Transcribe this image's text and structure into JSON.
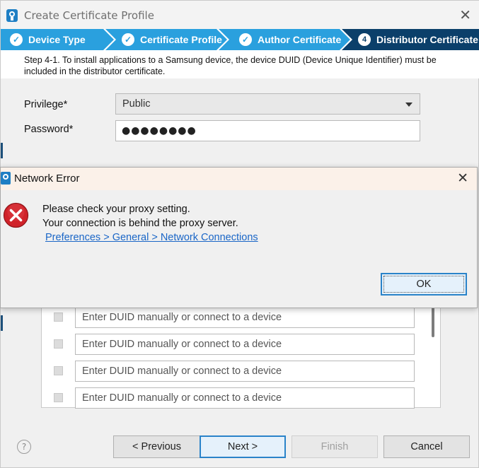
{
  "window": {
    "title": "Create Certificate Profile"
  },
  "steps": [
    {
      "label": "Device Type",
      "state": "done"
    },
    {
      "label": "Certificate Profile",
      "state": "done"
    },
    {
      "label": "Author Certificate",
      "state": "done"
    },
    {
      "label": "Distributor Certificate",
      "state": "active",
      "number": "4"
    }
  ],
  "description": "Step 4-1. To install applications to a Samsung device, the device DUID (Device Unique Identifier) must be included in the distributor certificate.",
  "form": {
    "privilege_label": "Privilege*",
    "privilege_value": "Public",
    "password_label": "Password*",
    "password_value": "●●●●●●●●"
  },
  "duid_rows": [
    {
      "placeholder": "Enter DUID manually or connect to a device"
    },
    {
      "placeholder": "Enter DUID manually or connect to a device"
    },
    {
      "placeholder": "Enter DUID manually or connect to a device"
    },
    {
      "placeholder": "Enter DUID manually or connect to a device"
    }
  ],
  "buttons": {
    "help": "?",
    "previous": "< Previous",
    "next": "Next >",
    "finish": "Finish",
    "cancel": "Cancel"
  },
  "dialog": {
    "title": "Network Error",
    "line1": "Please check your proxy setting.",
    "line2": "Your connection is behind the proxy server.",
    "link": "Preferences > General > Network Connections",
    "ok": "OK"
  },
  "colors": {
    "step_active": "#0b3f6a",
    "step_done": "#2aa0de",
    "link": "#1a66c7",
    "error_red": "#d0232a"
  },
  "icons": {
    "app": "tizen-certificate-icon",
    "check": "check-icon",
    "error": "error-x-icon",
    "close": "close-icon",
    "dropdown": "chevron-down-icon"
  }
}
